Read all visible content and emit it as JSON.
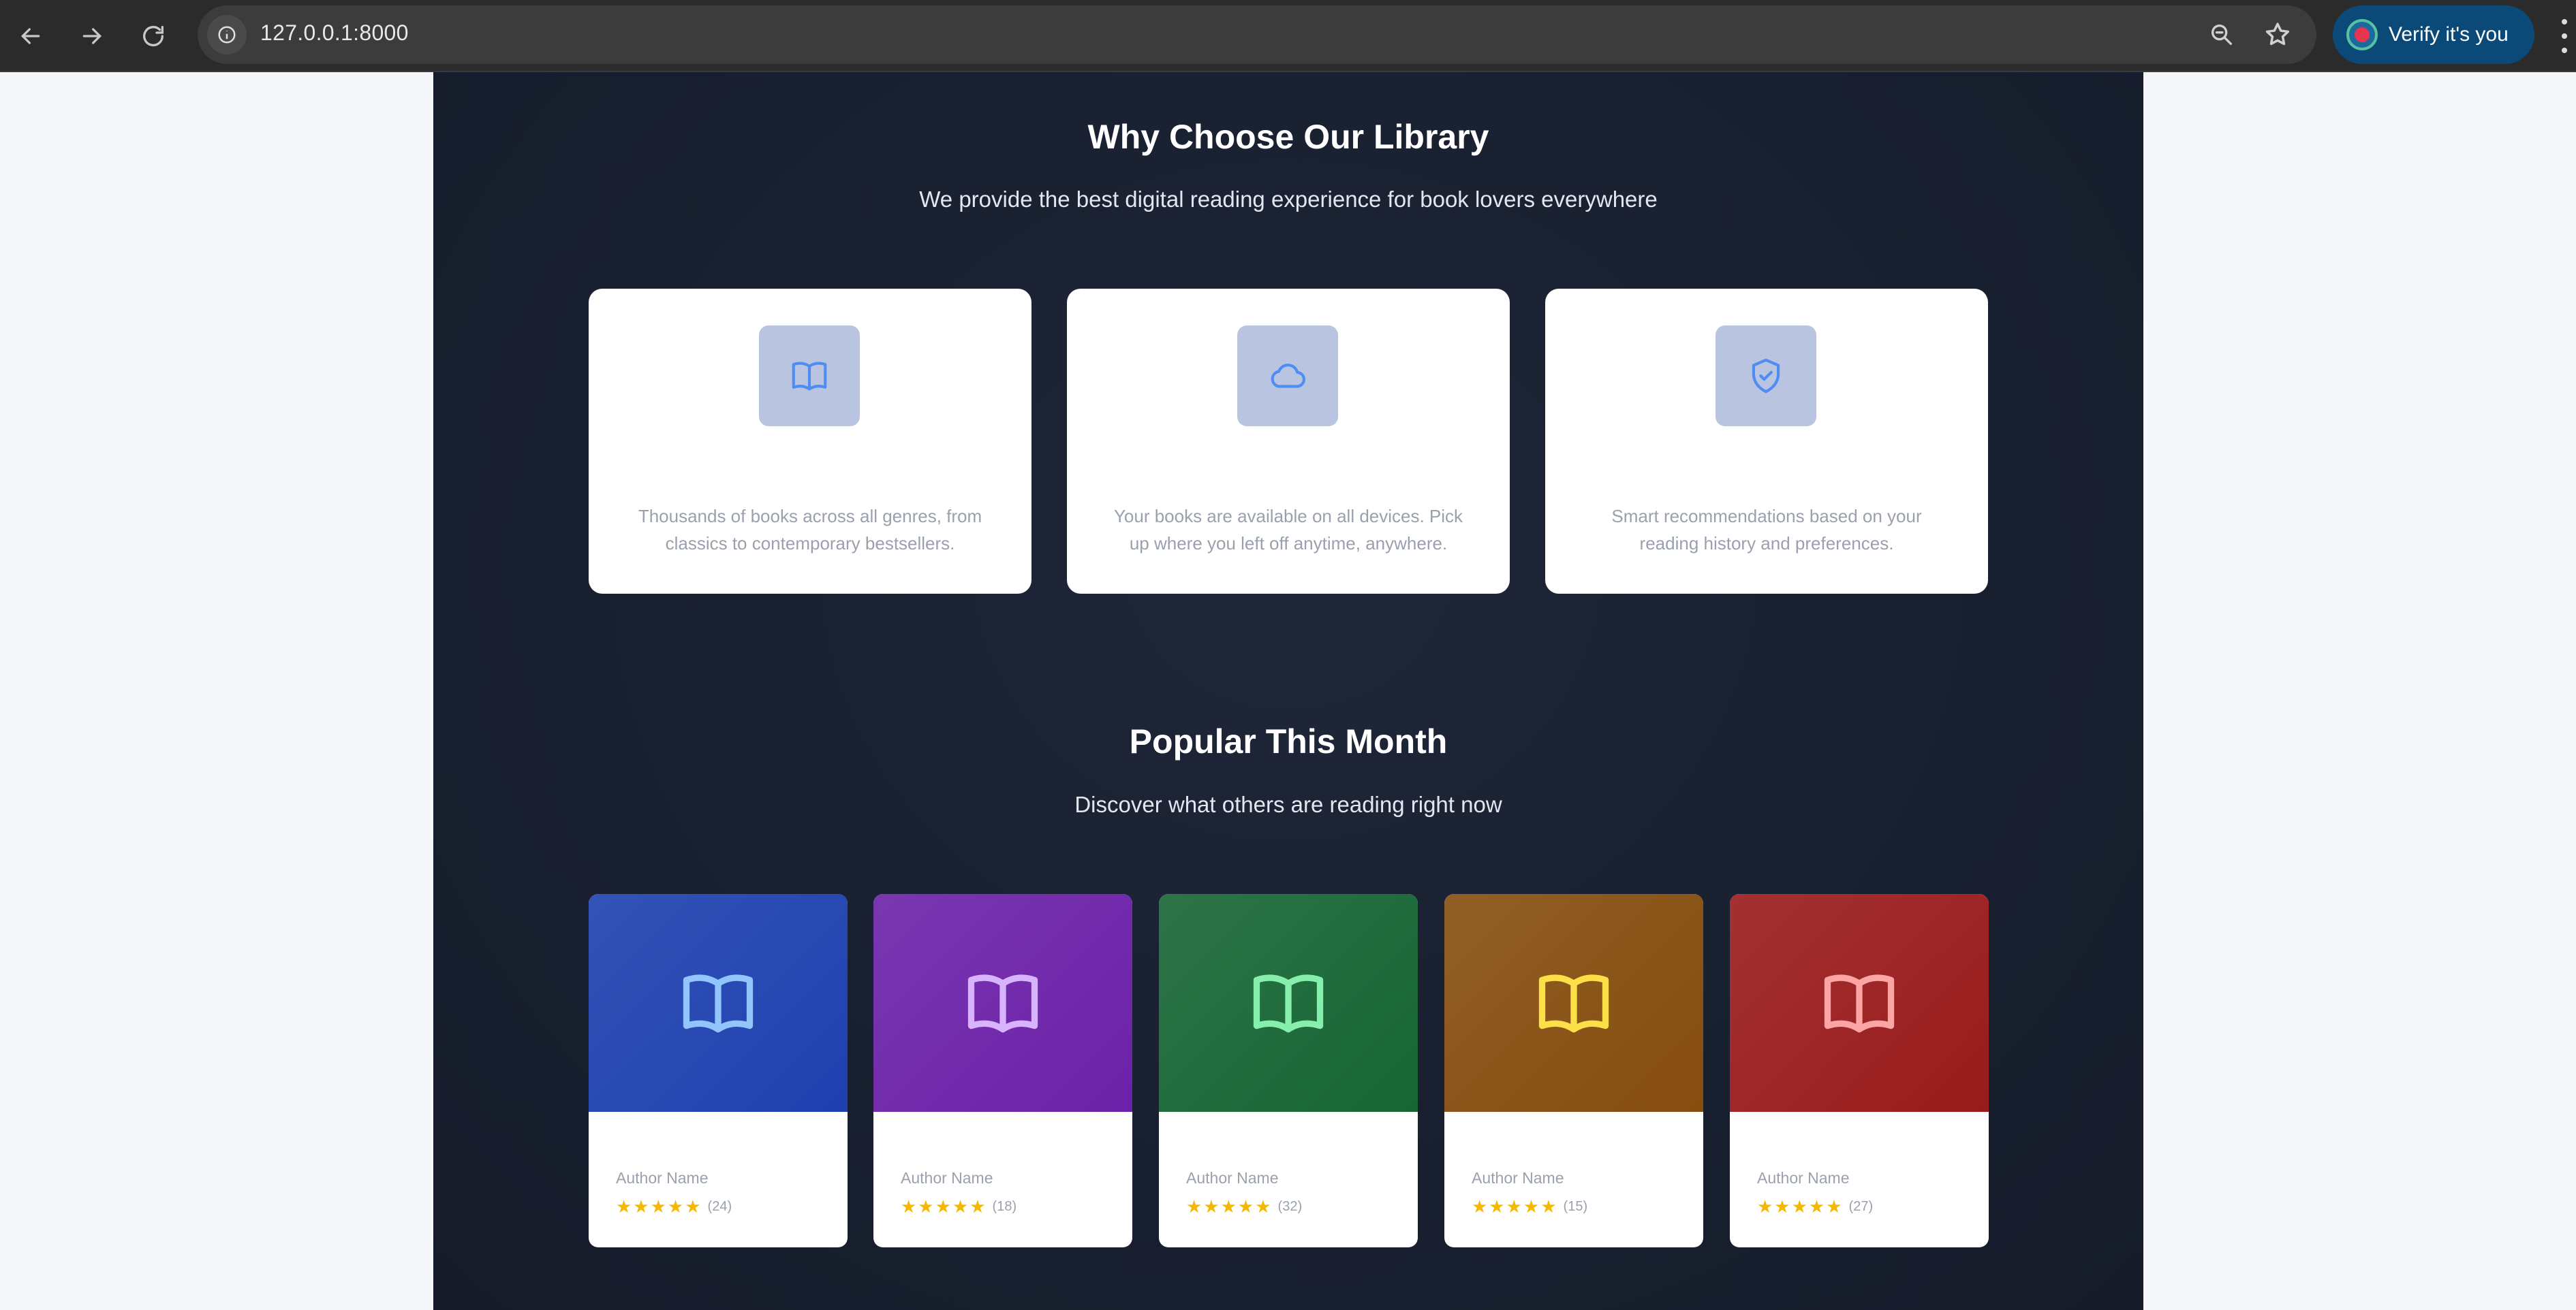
{
  "browser": {
    "url": "127.0.0.1:8000",
    "verify_label": "Verify it's you"
  },
  "features": {
    "title": "Why Choose Our Library",
    "subtitle": "We provide the best digital reading experience for book lovers everywhere",
    "items": [
      {
        "icon": "book-open-icon",
        "description": "Thousands of books across all genres, from classics to contemporary bestsellers."
      },
      {
        "icon": "cloud-icon",
        "description": "Your books are available on all devices. Pick up where you left off anytime, anywhere."
      },
      {
        "icon": "shield-check-icon",
        "description": "Smart recommendations based on your reading history and preferences."
      }
    ]
  },
  "popular": {
    "title": "Popular This Month",
    "subtitle": "Discover what others are reading right now",
    "books": [
      {
        "author": "Author Name",
        "stars": "★★★★★",
        "count": "(24)",
        "cover_color": "#1e40af",
        "icon_color": "#93c5fd"
      },
      {
        "author": "Author Name",
        "stars": "★★★★★",
        "count": "(18)",
        "cover_color": "#6b21a8",
        "icon_color": "#d8b4fe"
      },
      {
        "author": "Author Name",
        "stars": "★★★★★",
        "count": "(32)",
        "cover_color": "#166534",
        "icon_color": "#86efac"
      },
      {
        "author": "Author Name",
        "stars": "★★★★★",
        "count": "(15)",
        "cover_color": "#854d0e",
        "icon_color": "#fde047"
      },
      {
        "author": "Author Name",
        "stars": "★★★★★",
        "count": "(27)",
        "cover_color": "#991b1b",
        "icon_color": "#fca5a5"
      }
    ]
  },
  "colors": {
    "panel_bg": "#1a2133",
    "feature_icon_bg": "#b9c4e0",
    "feature_icon_stroke": "#4f8df5",
    "star": "#f5b800"
  }
}
